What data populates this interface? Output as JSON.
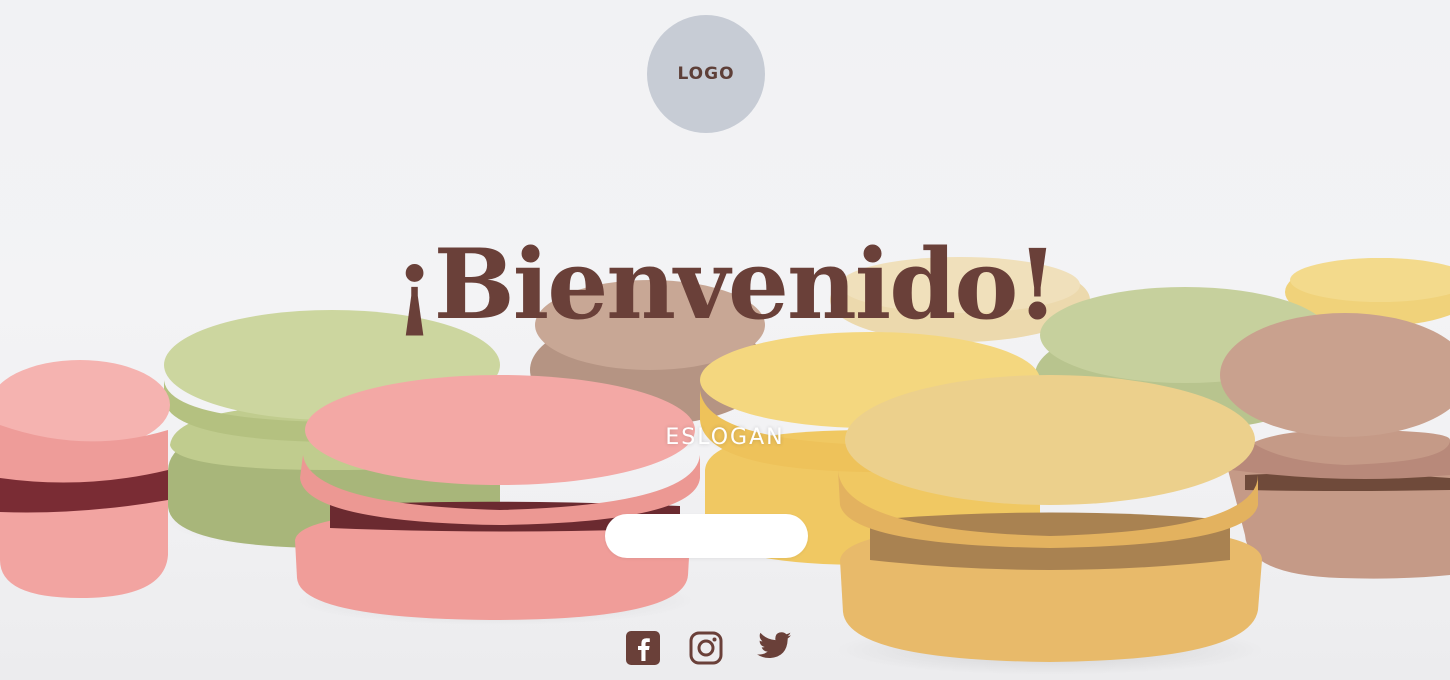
{
  "header": {
    "logo_text": "LOGO"
  },
  "hero": {
    "title": "¡Bienvenido!",
    "slogan": "ESLOGAN",
    "cta_label": ""
  },
  "social": [
    {
      "icon": "facebook-icon"
    },
    {
      "icon": "instagram-icon"
    },
    {
      "icon": "twitter-icon"
    }
  ],
  "colors": {
    "brand_brown": "#6a4039",
    "logo_circle": "#c7ccd5",
    "background": "#f1f2f4",
    "button": "#ffffff"
  }
}
